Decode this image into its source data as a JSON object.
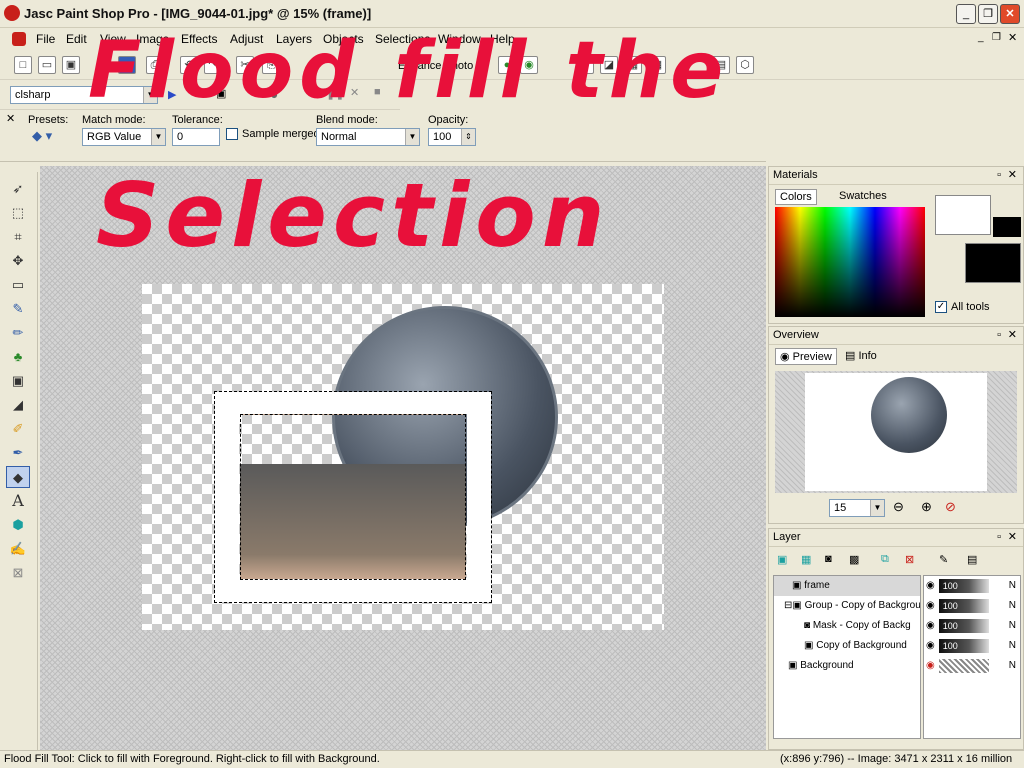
{
  "window": {
    "title": "Jasc Paint Shop Pro - [IMG_9044-01.jpg* @  15% (frame)]"
  },
  "menu": [
    "File",
    "Edit",
    "View",
    "Image",
    "Effects",
    "Adjust",
    "Layers",
    "Objects",
    "Selections",
    "Window",
    "Help"
  ],
  "toolbar": {
    "enhance_photo": "Enhance Photo",
    "script_combo": "clsharp"
  },
  "tool_options": {
    "presets_label": "Presets:",
    "match_mode_label": "Match mode:",
    "match_mode_value": "RGB Value",
    "tolerance_label": "Tolerance:",
    "tolerance_value": "0",
    "sample_merged_label": "Sample merged",
    "blend_mode_label": "Blend mode:",
    "blend_mode_value": "Normal",
    "opacity_label": "Opacity:",
    "opacity_value": "100"
  },
  "annotation": {
    "line1": "Flood fill the",
    "line2": "Selection",
    "color": "#e8103a"
  },
  "materials": {
    "title": "Materials",
    "tab_colors": "Colors",
    "tab_swatches": "Swatches",
    "all_tools_label": "All tools"
  },
  "overview": {
    "title": "Overview",
    "tab_preview": "Preview",
    "tab_info": "Info",
    "zoom_value": "15"
  },
  "layers_panel": {
    "title": "Layer",
    "layers": [
      {
        "name": "frame",
        "opacity": "100",
        "mode": "N"
      },
      {
        "name": "Group - Copy of Backgrou",
        "opacity": "100",
        "mode": "N"
      },
      {
        "name": "Mask - Copy of Backg",
        "opacity": "100",
        "mode": "N"
      },
      {
        "name": "Copy of Background",
        "opacity": "100",
        "mode": "N"
      },
      {
        "name": "Background",
        "opacity": "",
        "mode": "N"
      }
    ]
  },
  "status": {
    "left": "Flood Fill Tool: Click to fill with Foreground. Right-click to fill with Background.",
    "right": "(x:896 y:796) -- Image:  3471 x 2311 x 16 million"
  }
}
